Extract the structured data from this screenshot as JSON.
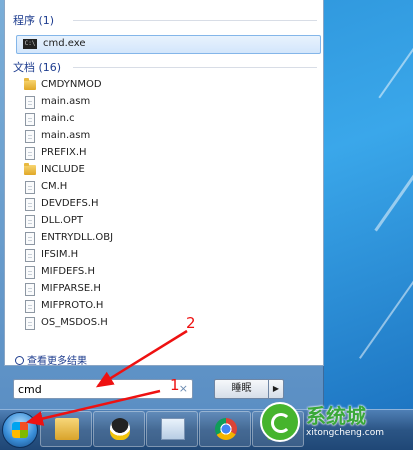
{
  "programs": {
    "title": "程序 (1)",
    "items": [
      {
        "label": "cmd.exe"
      }
    ]
  },
  "documents": {
    "title": "文档 (16)",
    "items": [
      {
        "label": "CMDYNMOD",
        "type": "folder"
      },
      {
        "label": "main.asm",
        "type": "file"
      },
      {
        "label": "main.c",
        "type": "file"
      },
      {
        "label": "main.asm",
        "type": "file"
      },
      {
        "label": "PREFIX.H",
        "type": "file"
      },
      {
        "label": "INCLUDE",
        "type": "folder"
      },
      {
        "label": "CM.H",
        "type": "file"
      },
      {
        "label": "DEVDEFS.H",
        "type": "file"
      },
      {
        "label": "DLL.OPT",
        "type": "file"
      },
      {
        "label": "ENTRYDLL.OBJ",
        "type": "file"
      },
      {
        "label": "IFSIM.H",
        "type": "file"
      },
      {
        "label": "MIFDEFS.H",
        "type": "file"
      },
      {
        "label": "MIFPARSE.H",
        "type": "file"
      },
      {
        "label": "MIFPROTO.H",
        "type": "file"
      },
      {
        "label": "OS_MSDOS.H",
        "type": "file"
      }
    ]
  },
  "see_more": "查看更多结果",
  "search": {
    "value": "cmd",
    "clear": "×"
  },
  "shutdown": {
    "label": "睡眠",
    "arrow": "▶"
  },
  "taskbar": {
    "items": [
      "explorer-icon",
      "qq-icon",
      "notepad-icon",
      "chrome-icon",
      "app-icon"
    ]
  },
  "annotations": {
    "one": "1",
    "two": "2"
  },
  "watermark": {
    "text": "系统城",
    "url": "xitongcheng.com"
  },
  "colors": {
    "accent": "#1e3d8f",
    "selection": "#d3e6fb",
    "annotation": "#ee1111"
  }
}
